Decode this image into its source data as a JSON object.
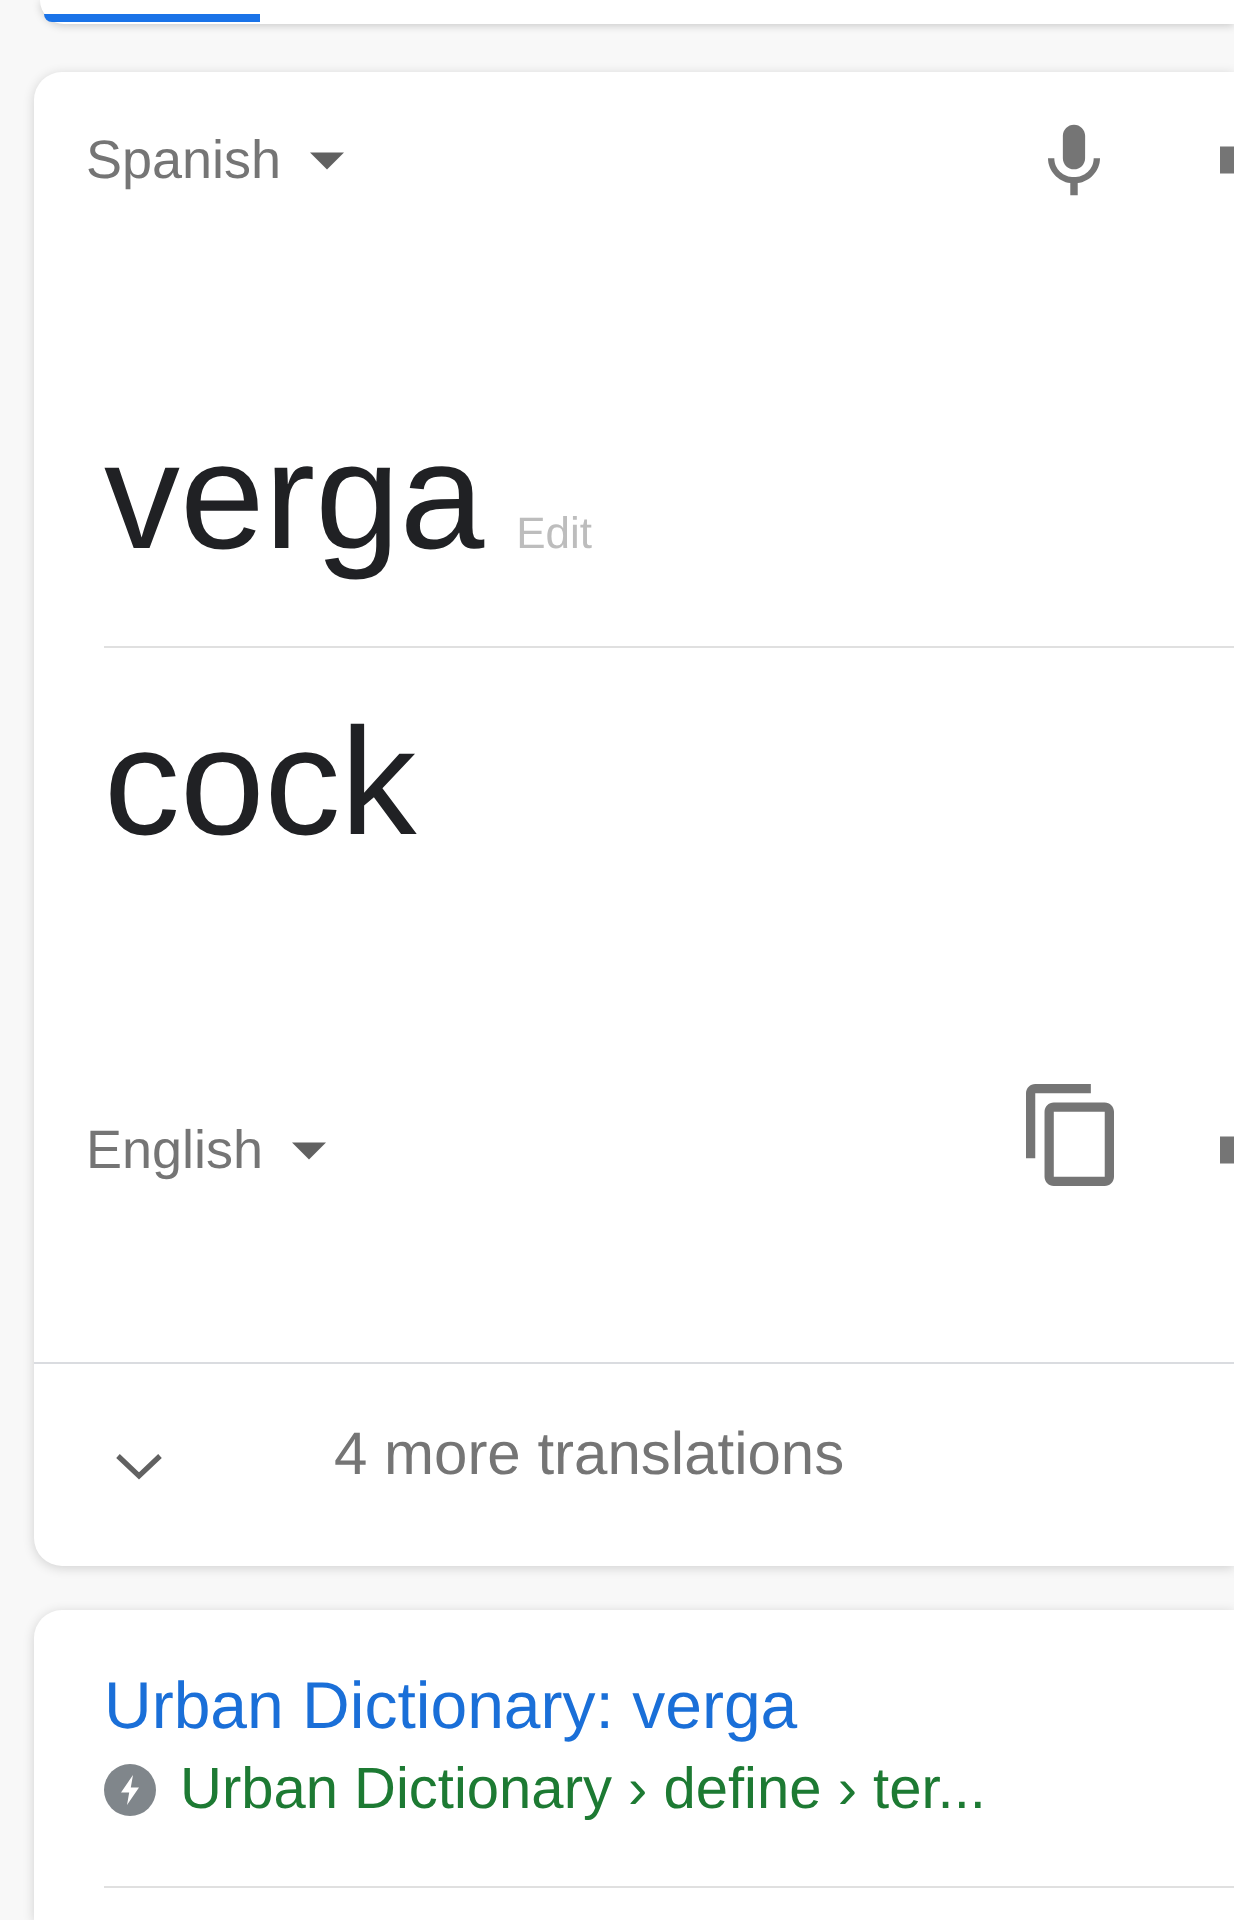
{
  "previous_card": {
    "tabs": [
      {
        "selected": true
      }
    ]
  },
  "translation_card": {
    "source_language": "Spanish",
    "source_text": "verga",
    "edit_label": "Edit",
    "translation": "cock",
    "target_language": "English",
    "more_translations": {
      "label": "4 more translations",
      "expanded": false
    }
  },
  "results": [
    {
      "title": "Urban Dictionary: verga",
      "breadcrumb": "Urban Dictionary › define › ter..."
    }
  ]
}
